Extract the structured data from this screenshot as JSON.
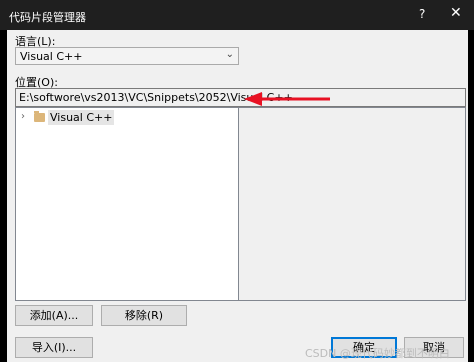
{
  "window": {
    "title": "代码片段管理器",
    "help_label": "?",
    "close_label": "✕"
  },
  "language": {
    "label": "语言(L):",
    "selected": "Visual C++",
    "arrow": "⌄"
  },
  "location": {
    "label": "位置(O):",
    "path": "E:\\softwore\\vs2013\\VC\\Snippets\\2052\\Visual C++"
  },
  "tree": {
    "items": [
      {
        "label": "Visual C++",
        "icon": "folder-icon",
        "expander": "›"
      }
    ]
  },
  "annotation": {
    "color": "#e81123"
  },
  "buttons": {
    "add": "添加(A)...",
    "remove": "移除(R)",
    "import": "导入(I)...",
    "ok": "确定",
    "cancel": "取消"
  },
  "watermark": "CSDN @现代码妙都到不明白"
}
